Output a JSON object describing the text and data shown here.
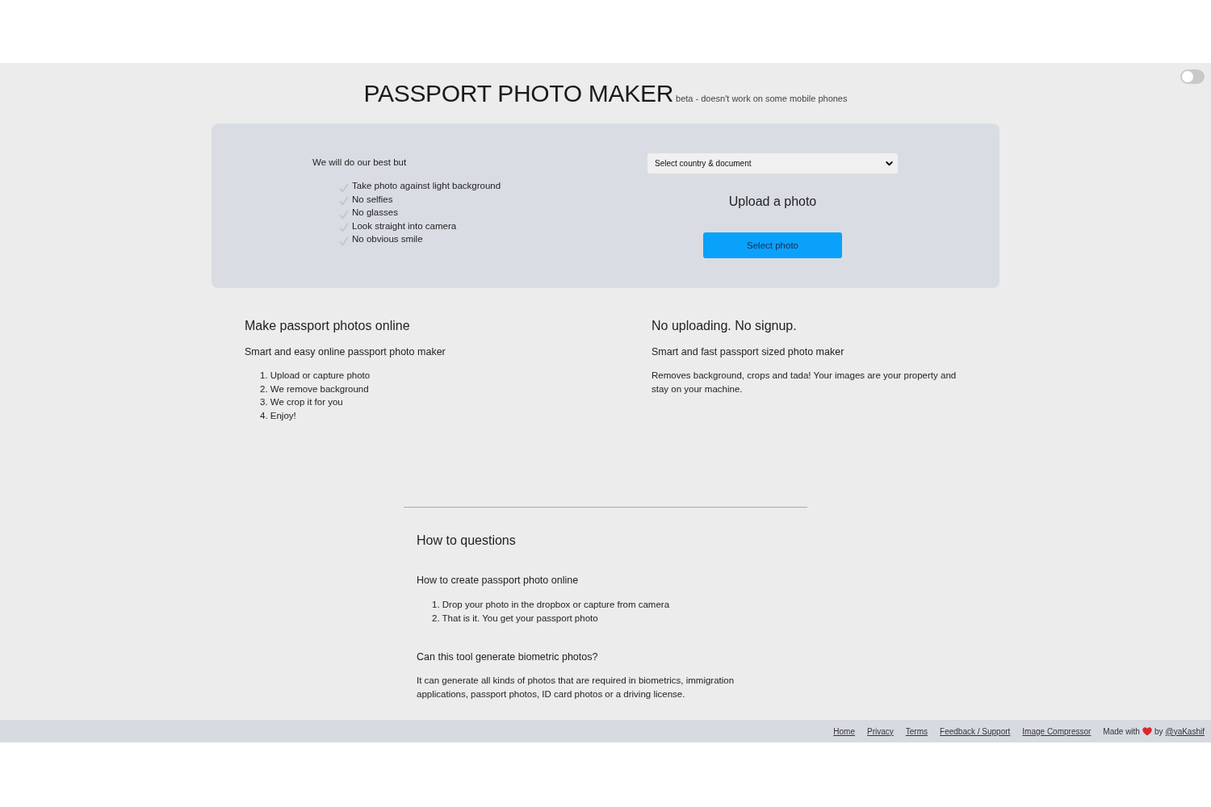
{
  "theme_toggle": {
    "on": false
  },
  "header": {
    "title": "PASSPORT PHOTO MAKER",
    "note": "beta - doesn't work on some mobile phones"
  },
  "upload_card": {
    "intro": "We will do our best but",
    "tips": [
      "Take photo against light background",
      "No selfies",
      "No glasses",
      "Look straight into camera",
      "No obvious smile"
    ],
    "document_select": {
      "value": "Select country & document"
    },
    "heading": "Upload a photo",
    "button": "Select photo"
  },
  "features": [
    {
      "heading": "Make passport photos online",
      "subheading": "Smart and easy online passport photo maker",
      "steps": [
        "1. Upload or capture photo",
        "2. We remove background",
        "3. We crop it for you",
        "4. Enjoy!"
      ]
    },
    {
      "heading": "No uploading. No signup.",
      "subheading": "Smart and fast passport sized photo maker",
      "paragraph": "Removes background, crops and tada! Your images are your property and stay on your machine."
    }
  ],
  "faq": {
    "title": "How to questions",
    "questions": [
      {
        "question": "How to create passport photo online",
        "steps": [
          "1. Drop your photo in the dropbox or capture from camera",
          "2. That is it. You get your passport photo"
        ]
      },
      {
        "question": "Can this tool generate biometric photos?",
        "answer": "It can generate all kinds of photos that are required in biometrics, immigration applications, passport photos, ID card photos or a driving license."
      }
    ]
  },
  "footer": {
    "links": [
      "Home",
      "Privacy",
      "Terms",
      "Feedback / Support",
      "Image Compressor"
    ],
    "credit": {
      "prefix": "Made with",
      "middle": "by",
      "link": "@yaKashif"
    }
  }
}
